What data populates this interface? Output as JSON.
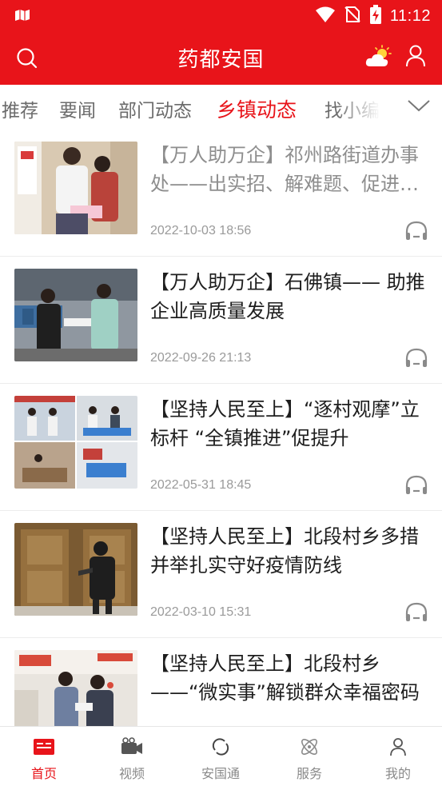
{
  "status_bar": {
    "time": "11:12"
  },
  "header": {
    "title": "药都安国"
  },
  "tabs": [
    {
      "label": "推荐"
    },
    {
      "label": "要闻"
    },
    {
      "label": "部门动态"
    },
    {
      "label": "乡镇动态",
      "active": true
    },
    {
      "label": "找小编"
    }
  ],
  "articles": [
    {
      "title": "【万人助万企】祁州路街道办事处——出实招、解难题、促进企业发展",
      "date": "2022-10-03 18:56",
      "read": true
    },
    {
      "title": "【万人助万企】石佛镇—— 助推企业高质量发展",
      "date": "2022-09-26 21:13",
      "read": false
    },
    {
      "title": "【坚持人民至上】“逐村观摩”立标杆 “全镇推进”促提升",
      "date": "2022-05-31 18:45",
      "read": false
    },
    {
      "title": "【坚持人民至上】北段村乡多措并举扎实守好疫情防线",
      "date": "2022-03-10 15:31",
      "read": false
    },
    {
      "title": "【坚持人民至上】北段村乡——“微实事”解锁群众幸福密码",
      "date": "",
      "read": false
    }
  ],
  "bottom_nav": [
    {
      "label": "首页",
      "icon": "home-newspaper-icon",
      "active": true
    },
    {
      "label": "视频",
      "icon": "video-camera-icon"
    },
    {
      "label": "安国通",
      "icon": "circle-refresh-icon"
    },
    {
      "label": "服务",
      "icon": "orbit-icon"
    },
    {
      "label": "我的",
      "icon": "person-icon"
    }
  ],
  "colors": {
    "brand": "#e8141a",
    "text": "#1e1e1e",
    "muted": "#9a9a9a"
  }
}
